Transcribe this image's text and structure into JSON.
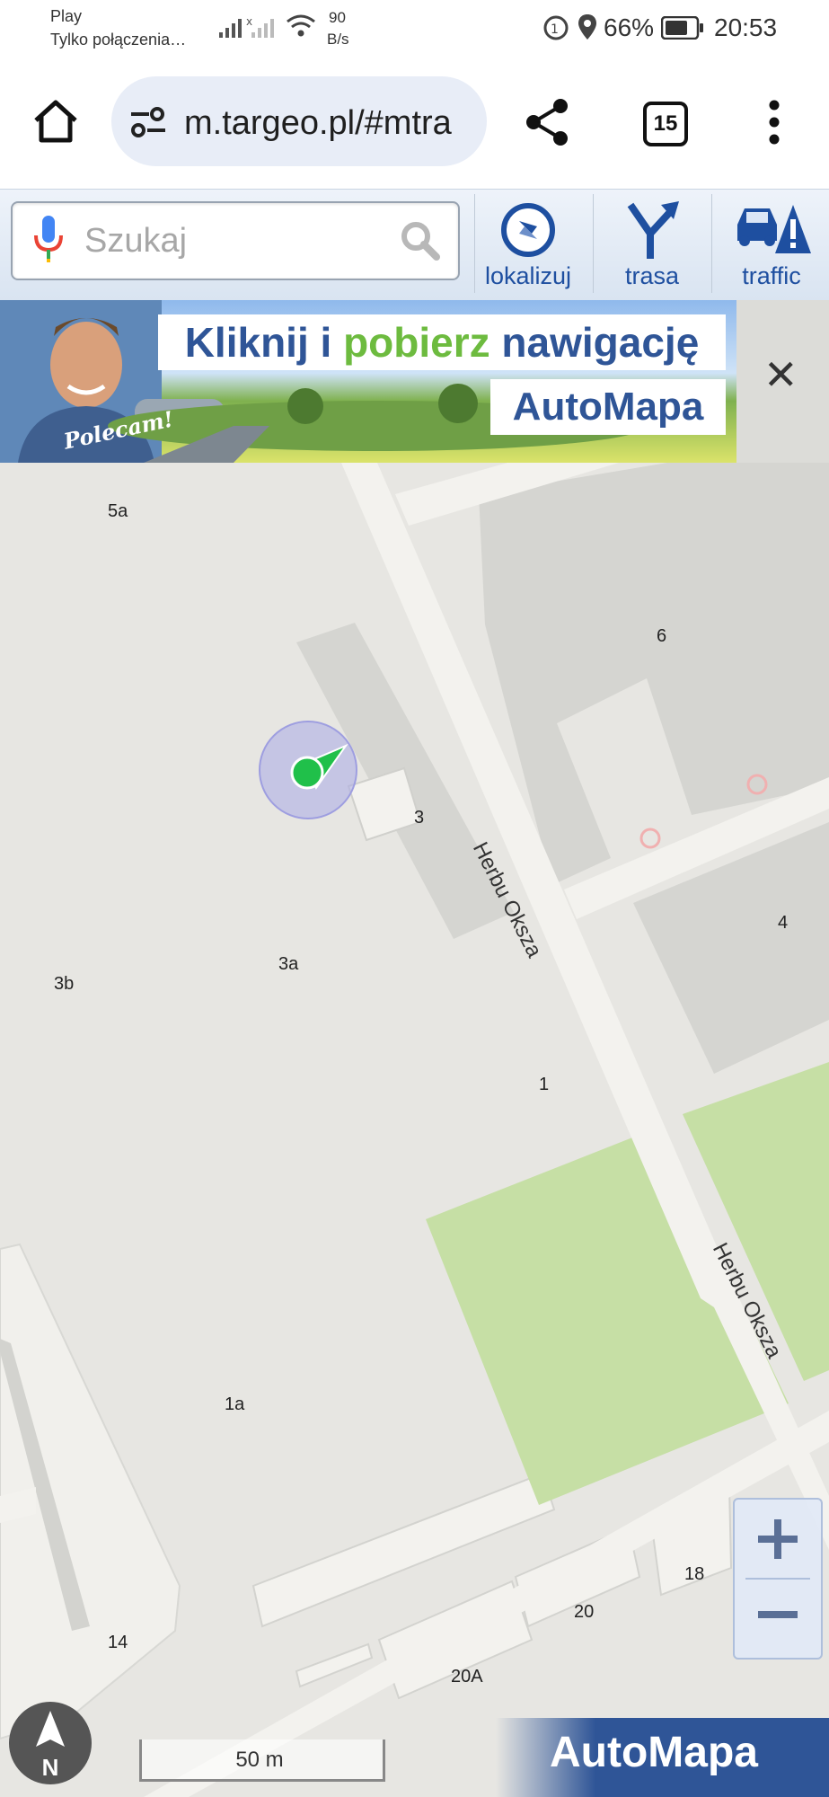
{
  "status_bar": {
    "carrier": "Play",
    "carrier_sub": "Tylko połączenia…",
    "net_speed_value": "90",
    "net_speed_unit": "B/s",
    "battery": "66%",
    "time": "20:53"
  },
  "browser": {
    "url": "m.targeo.pl/#mtra",
    "tab_count": "15"
  },
  "toolbar": {
    "search_placeholder": "Szukaj",
    "btn_locate": "lokalizuj",
    "btn_route": "trasa",
    "btn_traffic": "traffic"
  },
  "banner": {
    "headline_part1": "Kliknij i ",
    "headline_part2": "pobierz",
    "headline_part3": " nawigację",
    "brand": "AutoMapa",
    "badge": "Polecam!",
    "close": "✕"
  },
  "map": {
    "labels": {
      "n5a": "5a",
      "n6": "6",
      "n3": "3",
      "n4": "4",
      "n3b": "3b",
      "n3a": "3a",
      "n1": "1",
      "n1a": "1a",
      "n18": "18",
      "n20": "20",
      "n14": "14",
      "n20A": "20A"
    },
    "street1": "Herbu Oksza",
    "street2": "Herbu Oksza",
    "scale": "50 m",
    "compass_letter": "N",
    "footer_brand": "AutoMapa"
  },
  "colors": {
    "accent": "#1e4fa0",
    "map_bg": "#e7e6e2",
    "road": "#f3f2ee",
    "building": "#d5d5d1",
    "park": "#c6dfa5",
    "location": "#20c04a"
  },
  "icons": {
    "home": "home-icon",
    "settings": "tune-icon",
    "share": "share-icon",
    "menu": "more-vert-icon",
    "mic": "mic-icon",
    "search": "search-icon",
    "locate": "compass-icon",
    "route": "route-icon",
    "traffic": "traffic-icon"
  }
}
